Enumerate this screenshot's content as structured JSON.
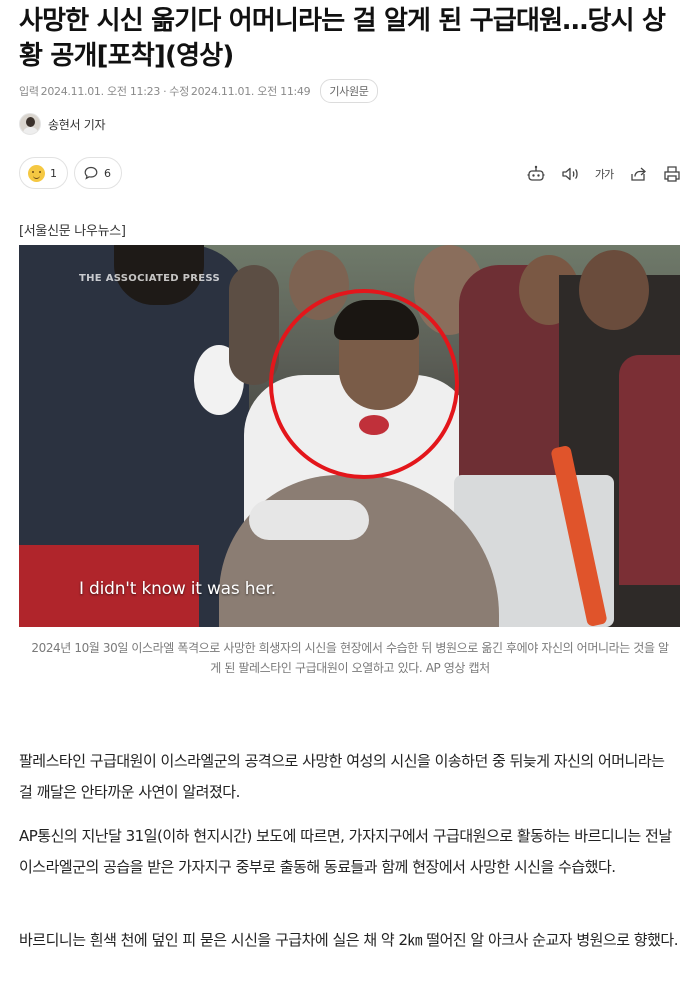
{
  "article": {
    "headline": "사망한 시신 옮기다 어머니라는 걸 알게 된 구급대원…당시 상황 공개[포착](영상)",
    "meta": {
      "input_label": "입력",
      "input_date": "2024.11.01. 오전 11:23",
      "separator": "·",
      "modified_label": "수정",
      "modified_date": "2024.11.01. 오전 11:49",
      "original_button": "기사원문"
    },
    "reporter": {
      "name": "송현서 기자"
    },
    "reactions": {
      "emoji_count": "1",
      "comment_count": "6"
    },
    "toolbar": {
      "icons": [
        "robot-icon",
        "speaker-icon",
        "font-size-icon",
        "share-icon",
        "print-icon"
      ],
      "font_size_label": "가가"
    },
    "source_label": "[서울신문 나우뉴스]",
    "image": {
      "watermark": "THE ASSOCIATED PRESS",
      "subtitle": "I didn't know it was her.",
      "highlight_color": "#e3161b"
    },
    "caption": "2024년 10월 30일 이스라엘 폭격으로 사망한 희생자의 시신을 현장에서 수습한 뒤 병원으로 옮긴 후에야 자신의 어머니라는 것을 알게 된 팔레스타인 구급대원이 오열하고 있다. AP 영상 캡처",
    "paragraphs": [
      "팔레스타인 구급대원이 이스라엘군의 공격으로 사망한 여성의 시신을 이송하던 중 뒤늦게 자신의 어머니라는 걸 깨달은 안타까운 사연이 알려졌다.",
      "AP통신의 지난달 31일(이하 현지시간) 보도에 따르면, 가자지구에서 구급대원으로 활동하는 바르디니는 전날 이스라엘군의 공습을 받은 가자지구 중부로 출동해 동료들과 함께 현장에서 사망한 시신을 수습했다.",
      "바르디니는 흰색 천에 덮인 피 묻은 시신을 구급차에 실은 채 약 2㎞ 떨어진 알 아크사 순교자 병원으로 향했다."
    ]
  }
}
